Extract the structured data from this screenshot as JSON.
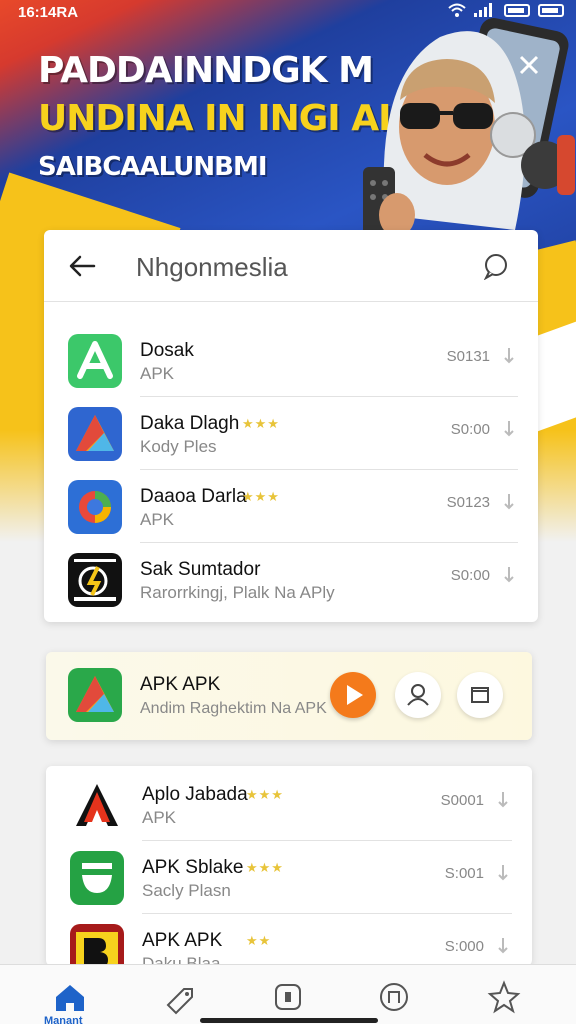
{
  "status_bar": {
    "time": "16:14RA"
  },
  "hero": {
    "line1": "PADDAINNDGK M",
    "line2": "UNDINA IN INGI AI",
    "line3": "SAIBCAALUNBMI"
  },
  "panel": {
    "title": "Nhgonmeslia",
    "apps": [
      {
        "name": "Dosak",
        "subtitle": "APK",
        "size": "S0131",
        "stars": ""
      },
      {
        "name": "Daka Dlagh",
        "subtitle": "Kody Ples",
        "size": "S0:00",
        "stars": "★★★"
      },
      {
        "name": "Daaoa Darla",
        "subtitle": "APK",
        "size": "S0123",
        "stars": "★★★"
      },
      {
        "name": "Sak Sumtador",
        "subtitle": "Rarorrkingj, Plalk Na APly",
        "size": "S0:00",
        "stars": ""
      }
    ]
  },
  "featured": {
    "name": "APK APK",
    "subtitle": "Andim Raghektim Na APK"
  },
  "more_apps": [
    {
      "name": "Aplo Jabada",
      "subtitle": "APK",
      "size": "S0001",
      "stars": "★★★"
    },
    {
      "name": "APK Sblake",
      "subtitle": "Sacly Plasn",
      "size": "S:001",
      "stars": "★★★"
    },
    {
      "name": "APK APK",
      "subtitle": "Daku Blaa",
      "size": "S:000",
      "stars": "★★"
    }
  ],
  "bottom_nav": {
    "home_label": "Manant"
  },
  "colors": {
    "accent_blue": "#1e63c9",
    "play_orange": "#f47a1b",
    "star_yellow": "#e8c43a"
  }
}
